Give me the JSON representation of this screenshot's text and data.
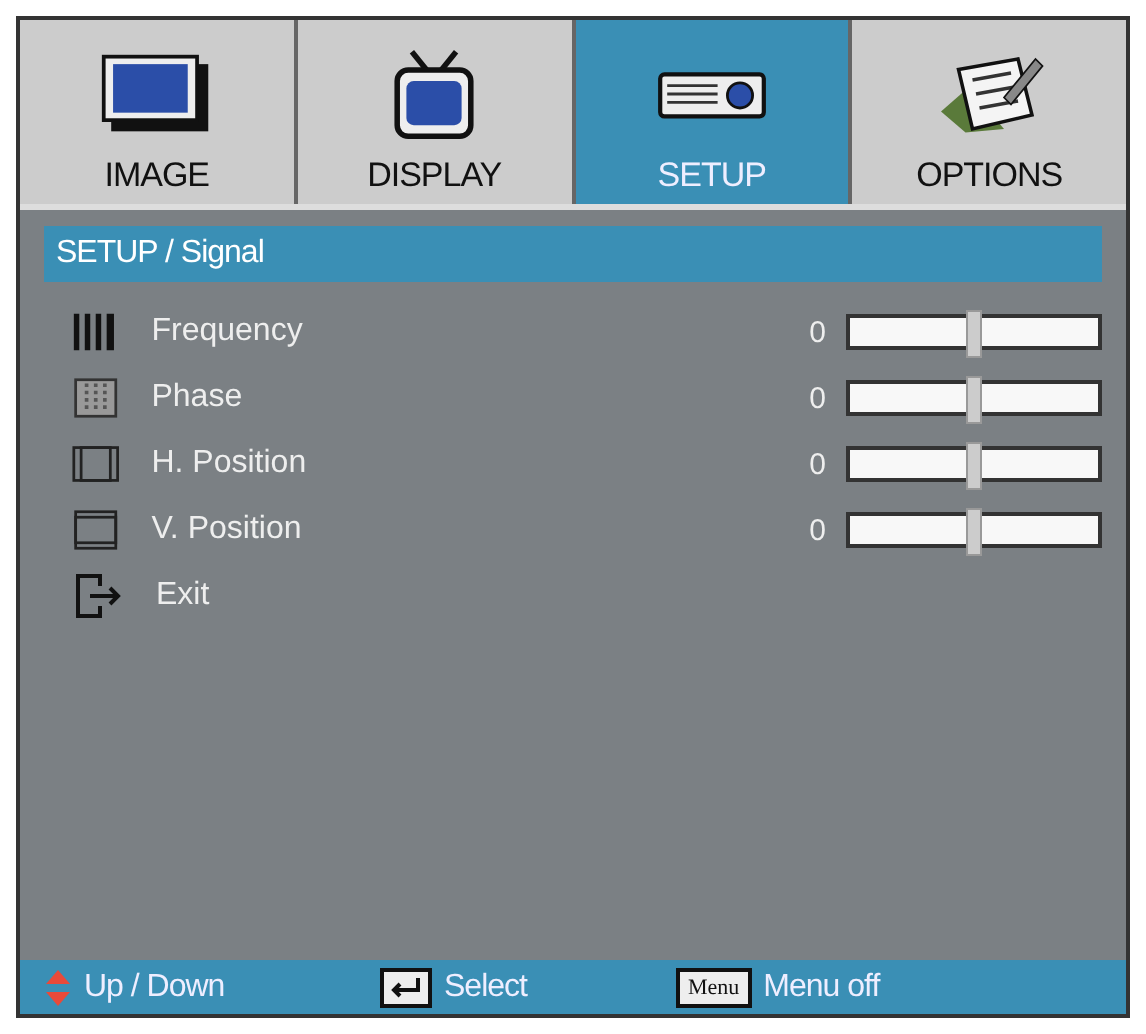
{
  "tabs": [
    {
      "label": "IMAGE",
      "selected": false
    },
    {
      "label": "DISPLAY",
      "selected": false
    },
    {
      "label": "SETUP",
      "selected": true
    },
    {
      "label": "OPTIONS",
      "selected": false
    }
  ],
  "breadcrumb": "SETUP / Signal",
  "items": [
    {
      "kind": "slider",
      "label": "Frequency",
      "reading": "0",
      "level": 0.5
    },
    {
      "kind": "slider",
      "label": "Phase",
      "reading": "0",
      "level": 0.5
    },
    {
      "kind": "slider",
      "label": "H. Position",
      "reading": "0",
      "level": 0.5
    },
    {
      "kind": "slider",
      "label": "V. Position",
      "reading": "0",
      "level": 0.5
    },
    {
      "kind": "action",
      "label": "Exit"
    }
  ],
  "footer": [
    {
      "kind": "updown",
      "label": "Up / Down"
    },
    {
      "kind": "enter",
      "label": "Select"
    },
    {
      "kind": "menu",
      "key": "Menu",
      "label": "Menu off"
    }
  ]
}
